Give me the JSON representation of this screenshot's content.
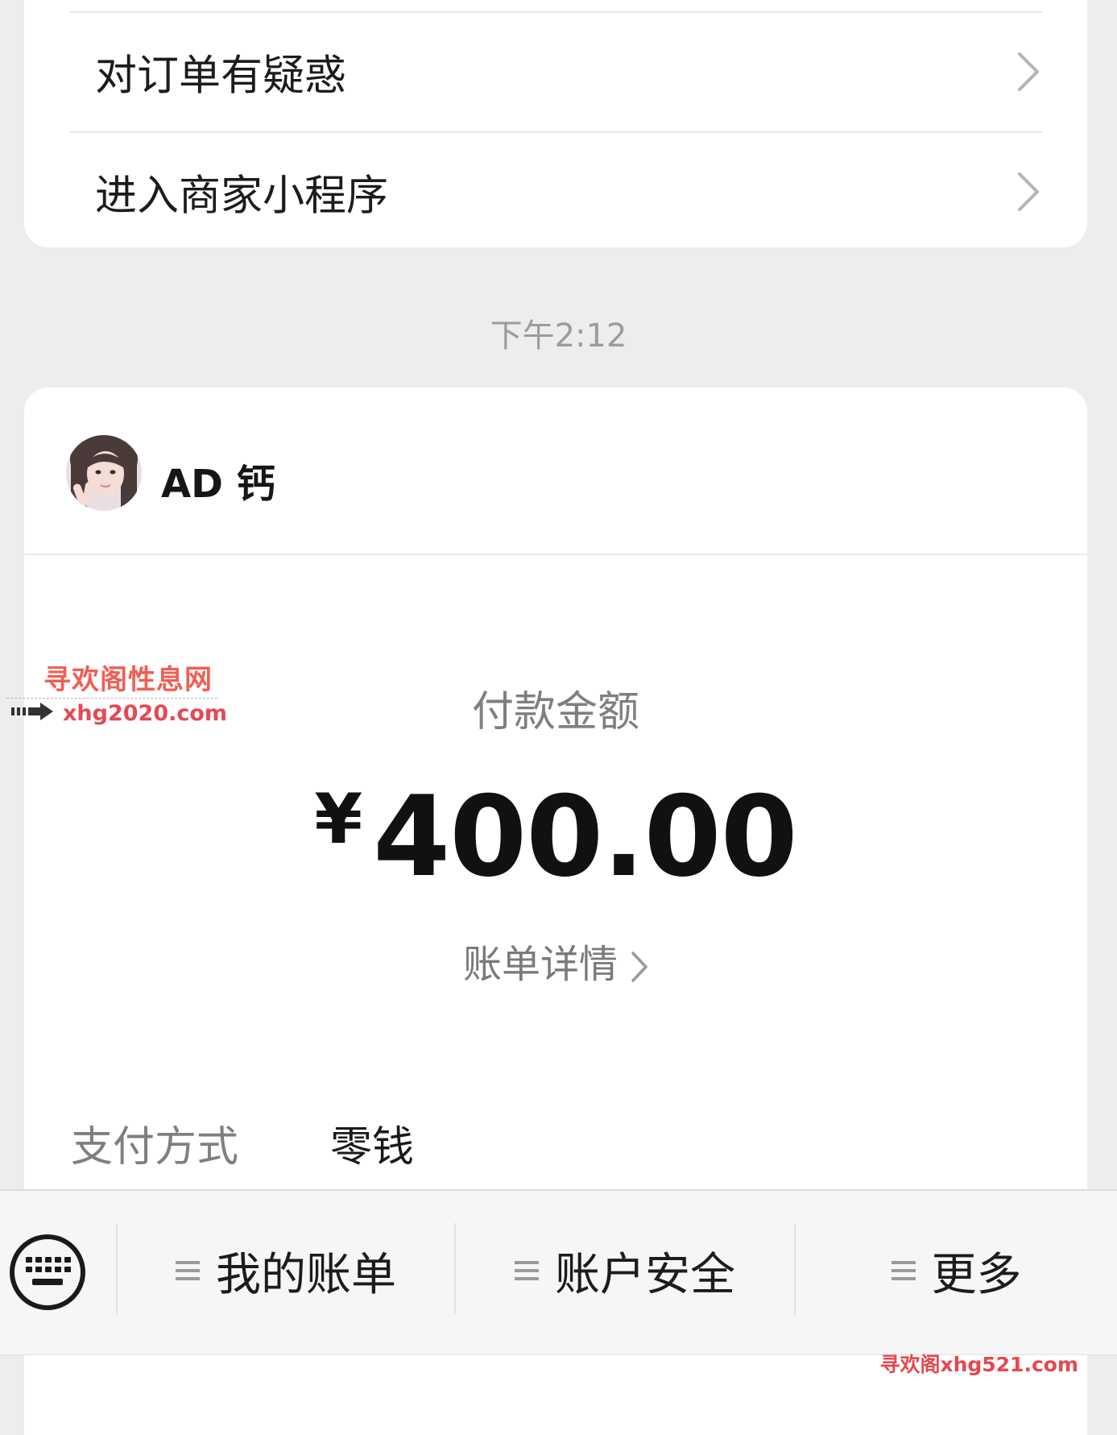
{
  "menu": {
    "items": [
      {
        "label": "对订单有疑惑"
      },
      {
        "label": "进入商家小程序"
      }
    ]
  },
  "timestamp": "下午2:12",
  "payment": {
    "merchant_name": "AD 钙",
    "amount_label": "付款金额",
    "currency_symbol": "¥",
    "amount": "400.00",
    "detail_link": "账单详情",
    "method_label": "支付方式",
    "method_value": "零钱"
  },
  "watermarks": {
    "site_name": "寻欢阁性息网",
    "site_url": "xhg2020.com",
    "corner_text": "寻欢阁xhg521.com"
  },
  "bottom_bar": {
    "tabs": [
      {
        "label": "我的账单"
      },
      {
        "label": "账户安全"
      },
      {
        "label": "更多"
      }
    ]
  },
  "colors": {
    "background": "#ededed",
    "card": "#ffffff",
    "watermark_red": "#e5484f"
  }
}
